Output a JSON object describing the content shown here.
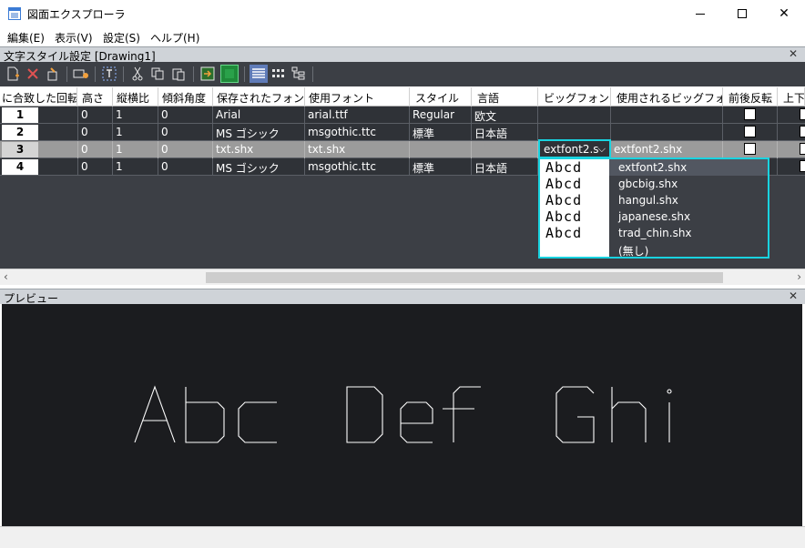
{
  "window": {
    "title": "図面エクスプローラ"
  },
  "menu": [
    "編集(E)",
    "表示(V)",
    "設定(S)",
    "ヘルプ(H)"
  ],
  "text_style_panel": {
    "title": "文字スタイル設定 [Drawing1]"
  },
  "toolbar": {
    "icons": [
      "new-style-icon",
      "delete-icon",
      "purge-icon",
      "set-current-icon",
      "text-style-icon",
      "cut-icon",
      "copy-icon",
      "paste-icon",
      "import-icon",
      "export-icon",
      "list-view-icon",
      "grid-view-icon",
      "tree-view-icon"
    ]
  },
  "table": {
    "headers": [
      "に合致した回転",
      "高さ",
      "縦横比",
      "傾斜角度",
      "保存されたフォント",
      "使用フォント",
      "スタイル",
      "言語",
      "ビッグフォント",
      "使用されるビッグフォント",
      "前後反転",
      "上下"
    ],
    "rows": [
      {
        "num": "1",
        "height": "0",
        "width_factor": "1",
        "oblique": "0",
        "saved_font": "Arial",
        "used_font": "arial.ttf",
        "style": "Regular",
        "language": "欧文",
        "bigfont": "",
        "used_bigfont": "",
        "selected": false
      },
      {
        "num": "2",
        "height": "0",
        "width_factor": "1",
        "oblique": "0",
        "saved_font": "MS ゴシック",
        "used_font": "msgothic.ttc",
        "style": "標準",
        "language": "日本語",
        "bigfont": "",
        "used_bigfont": "",
        "selected": false
      },
      {
        "num": "3",
        "height": "0",
        "width_factor": "1",
        "oblique": "0",
        "saved_font": "txt.shx",
        "used_font": "txt.shx",
        "style": "",
        "language": "",
        "bigfont": "extfont2.s",
        "used_bigfont": "extfont2.shx",
        "selected": true
      },
      {
        "num": "4",
        "height": "0",
        "width_factor": "1",
        "oblique": "0",
        "saved_font": "MS ゴシック",
        "used_font": "msgothic.ttc",
        "style": "標準",
        "language": "日本語",
        "bigfont": "",
        "used_bigfont": "",
        "selected": false
      }
    ]
  },
  "bigfont_dropdown": {
    "value": "extfont2.s",
    "options": [
      {
        "label": "extfont2.shx",
        "preview": "Abcd"
      },
      {
        "label": "gbcbig.shx",
        "preview": "Abcd"
      },
      {
        "label": "hangul.shx",
        "preview": "Abcd"
      },
      {
        "label": "japanese.shx",
        "preview": "Abcd"
      },
      {
        "label": "trad_chin.shx",
        "preview": "Abcd"
      },
      {
        "label": "(無し)",
        "preview": ""
      }
    ],
    "highlighted": "extfont2.shx"
  },
  "preview_panel": {
    "title": "プレビュー",
    "sample_words": [
      "Abc",
      "Def",
      "Ghi"
    ],
    "stroke_color": "#ffffff",
    "background": "#1b1c1f"
  },
  "colors": {
    "accent": "#19d3e0",
    "toolbar_bg": "#3c3f45",
    "grid_bg": "#3c3f45",
    "selected_row": "#9b9b9b"
  }
}
